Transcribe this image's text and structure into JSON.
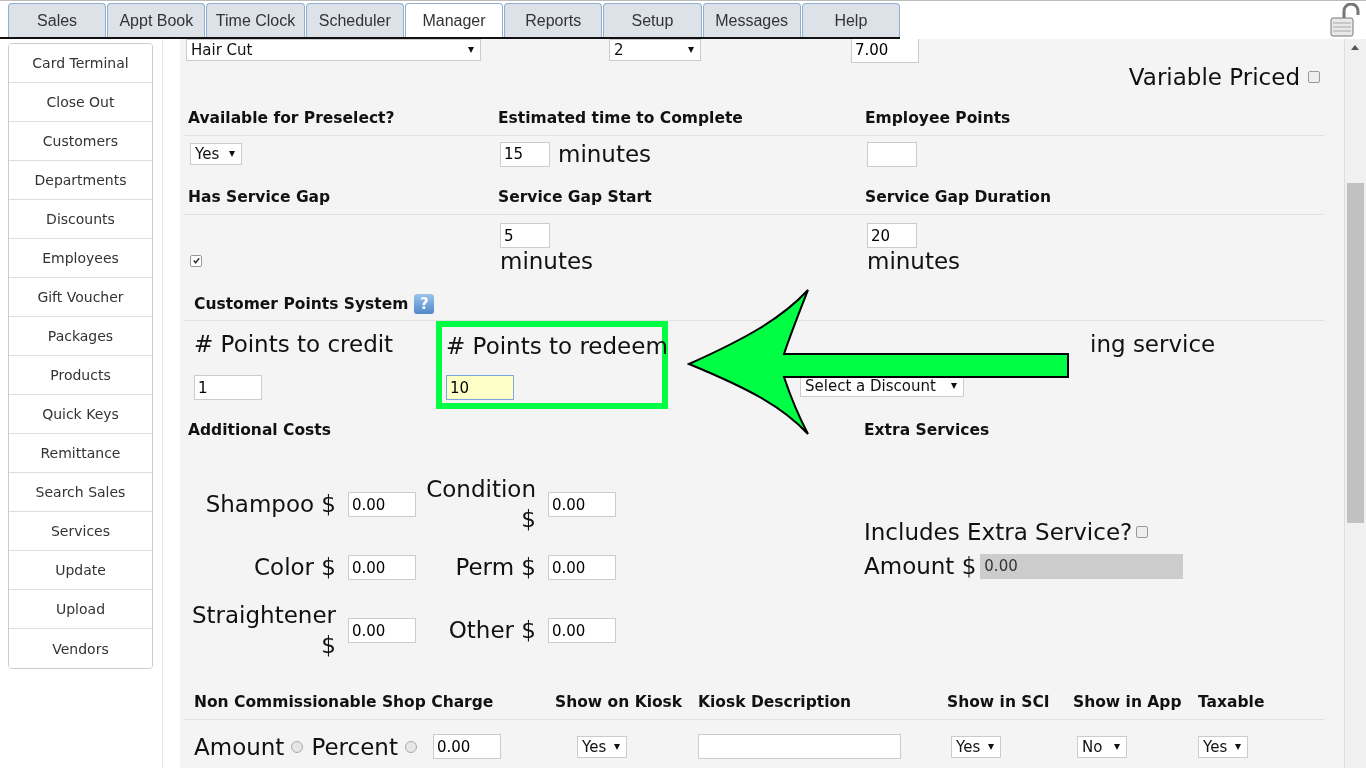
{
  "tabs": [
    {
      "label": "Sales",
      "selected": false
    },
    {
      "label": "Appt Book",
      "selected": false
    },
    {
      "label": "Time Clock",
      "selected": false
    },
    {
      "label": "Scheduler",
      "selected": false
    },
    {
      "label": "Manager",
      "selected": true
    },
    {
      "label": "Reports",
      "selected": false
    },
    {
      "label": "Setup",
      "selected": false
    },
    {
      "label": "Messages",
      "selected": false
    },
    {
      "label": "Help",
      "selected": false
    }
  ],
  "sidebar": {
    "items": [
      "Card Terminal",
      "Close Out",
      "Customers",
      "Departments",
      "Discounts",
      "Employees",
      "Gift Voucher",
      "Packages",
      "Products",
      "Quick Keys",
      "Remittance",
      "Search Sales",
      "Services",
      "Update",
      "Upload",
      "Vendors"
    ]
  },
  "service_row": {
    "service": "Hair Cut",
    "quantity": "2",
    "price": "7.00",
    "variable_priced": {
      "label": "Variable Priced",
      "checked": false
    }
  },
  "preselect": {
    "heading": "Available for Preselect?",
    "value": "Yes"
  },
  "estimated_time": {
    "heading": "Estimated time to Complete",
    "value": "15",
    "unit": "minutes"
  },
  "employee_points": {
    "heading": "Employee Points"
  },
  "service_gap": {
    "heading": "Has Service Gap",
    "checked": true
  },
  "gap_start": {
    "heading": "Service Gap Start",
    "value": "5",
    "unit": "minutes"
  },
  "gap_duration": {
    "heading": "Service Gap Duration",
    "value": "20",
    "unit": "minutes"
  },
  "customer_points": {
    "heading": "Customer Points System",
    "help": "?",
    "fields": [
      {
        "label": "# Points to credit",
        "value": "1",
        "highlighted": false
      },
      {
        "label": "# Points to redeem",
        "value": "10",
        "highlighted": true
      }
    ],
    "discount": {
      "label": "ing service",
      "value": "Select a Discount"
    }
  },
  "additional_costs": {
    "heading": "Additional Costs",
    "items": [
      {
        "label": "Shampoo $",
        "value": "0.00"
      },
      {
        "label": "Color $",
        "value": "0.00"
      },
      {
        "label": "Straightener $",
        "value": "0.00"
      },
      {
        "label": "Condition $",
        "value": "0.00"
      },
      {
        "label": "Perm $",
        "value": "0.00"
      },
      {
        "label": "Other $",
        "value": "0.00"
      }
    ]
  },
  "extra_services": {
    "heading": "Extra Services",
    "includes": {
      "label": "Includes Extra Service?",
      "checked": false
    },
    "amount": {
      "label": "Amount $",
      "value": "0.00",
      "disabled": true
    }
  },
  "shop_charge": {
    "headings": [
      "Non Commissionable Shop Charge",
      "Show on Kiosk",
      "Kiosk Description",
      "Show in SCI",
      "Show in App",
      "Taxable"
    ],
    "options": [
      {
        "label": "Amount",
        "selected": false
      },
      {
        "label": "Percent",
        "selected": false
      }
    ],
    "value": "0.00",
    "show_on_kiosk": "Yes",
    "show_in_sci": "Yes",
    "show_in_app": "No",
    "taxable": "Yes"
  }
}
